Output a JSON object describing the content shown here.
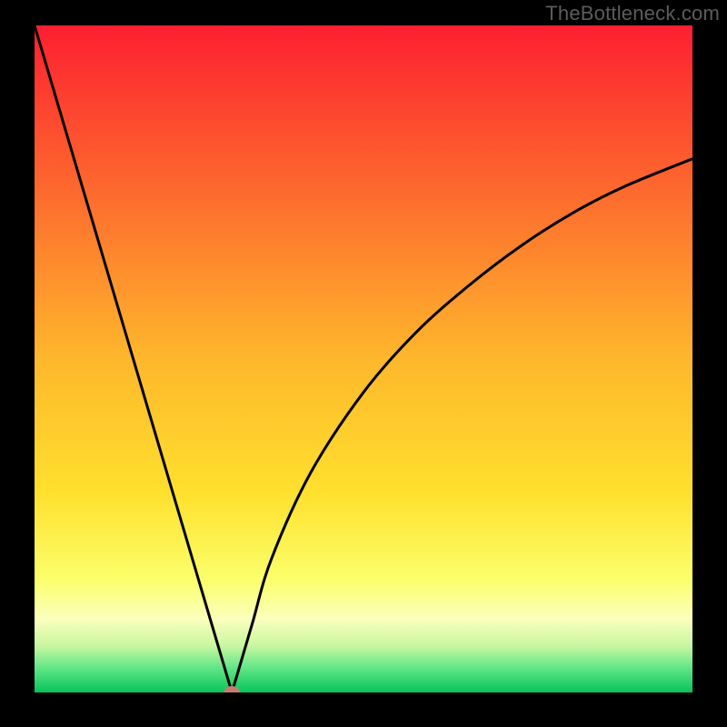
{
  "watermark": "TheBottleneck.com",
  "colors": {
    "frame": "#000000",
    "top": "#fd2330",
    "mid": "#ffd82d",
    "bottom_band": "#fcffb0",
    "green": "#10cc5f",
    "curve": "#000000",
    "marker": "#c47e6f"
  },
  "chart_data": {
    "type": "line",
    "title": "",
    "xlabel": "",
    "ylabel": "",
    "xlim": [
      0,
      100
    ],
    "ylim": [
      0,
      100
    ],
    "notch_x": 30,
    "x": [
      0,
      3,
      6,
      9,
      12,
      15,
      18,
      21,
      24,
      27,
      30,
      33,
      36,
      42,
      50,
      58,
      66,
      74,
      82,
      90,
      100
    ],
    "values": [
      100,
      90,
      80,
      70,
      60,
      50,
      40,
      30,
      20,
      10,
      0,
      10,
      20,
      33,
      45,
      54,
      61,
      67,
      72,
      76,
      80
    ],
    "marker": {
      "x": 30,
      "y": 0
    },
    "gradient_stops": [
      {
        "pos": 0.0,
        "c": "#fd1f30"
      },
      {
        "pos": 0.25,
        "c": "#fd6a2e"
      },
      {
        "pos": 0.5,
        "c": "#feb72c"
      },
      {
        "pos": 0.7,
        "c": "#ffe02d"
      },
      {
        "pos": 0.83,
        "c": "#fbff6a"
      },
      {
        "pos": 0.89,
        "c": "#fbffbc"
      },
      {
        "pos": 0.93,
        "c": "#c8f7a1"
      },
      {
        "pos": 0.965,
        "c": "#5de586"
      },
      {
        "pos": 1.0,
        "c": "#06c359"
      }
    ]
  }
}
